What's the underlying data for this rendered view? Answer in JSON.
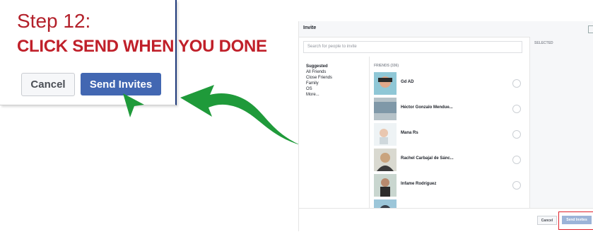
{
  "callout": {
    "step": "Step 12:",
    "headline": "CLICK SEND WHEN YOU DONE",
    "cancel_label": "Cancel",
    "send_label": "Send Invites"
  },
  "dialog": {
    "title": "Invite",
    "search_placeholder": "Search for people to invite",
    "selected_label": "SELECTED",
    "nav": [
      "Suggested",
      "All Friends",
      "Close Friends",
      "Family",
      "OS",
      "More..."
    ],
    "friends_header": "FRIENDS (336)",
    "friends": [
      {
        "name": "Gd AD"
      },
      {
        "name": "Héctor Gonzalo Mendue..."
      },
      {
        "name": "Mana Rs"
      },
      {
        "name": "Rachel Carbajal de Sánc..."
      },
      {
        "name": "Infame Rodríguez"
      }
    ],
    "footer": {
      "cancel_label": "Cancel",
      "send_label": "Send Invites"
    }
  },
  "colors": {
    "accent_red": "#c0202a",
    "primary_blue": "#4267b2",
    "arrow_green": "#1f9a3a"
  }
}
